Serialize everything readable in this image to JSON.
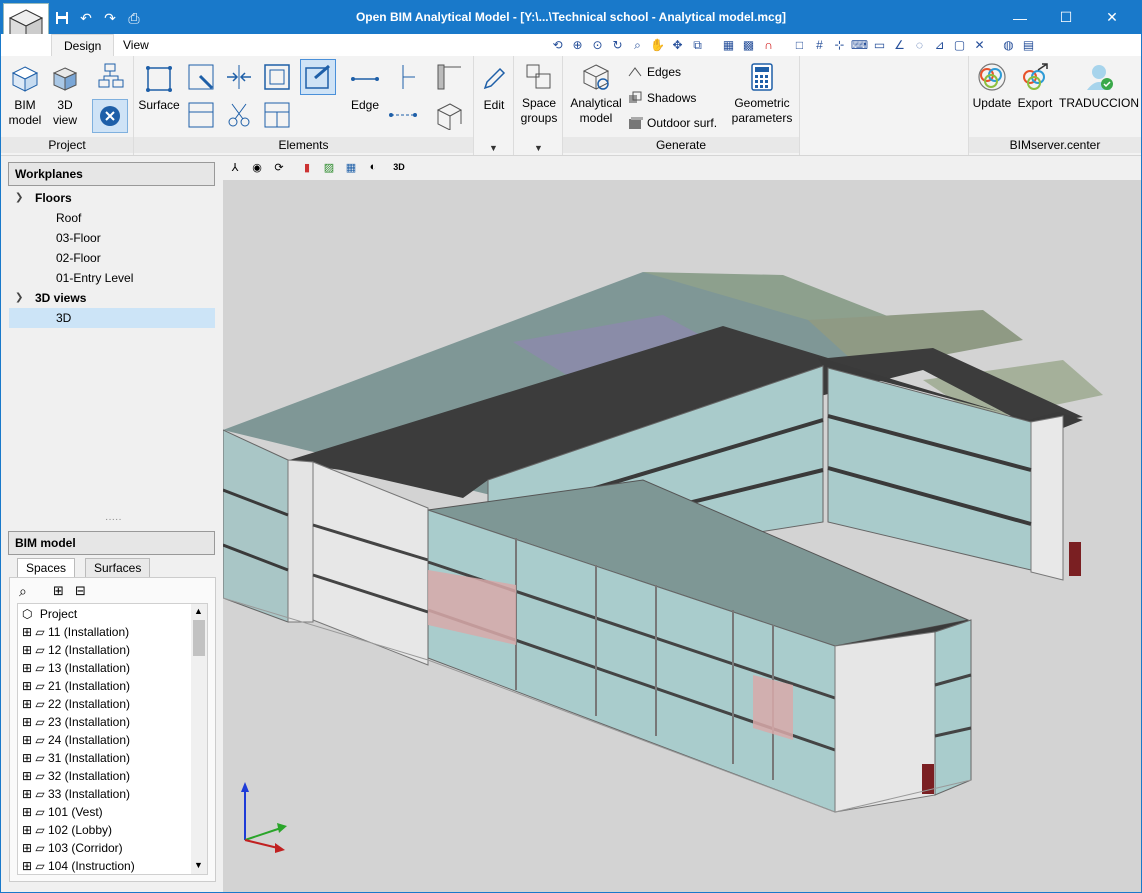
{
  "window": {
    "title": "Open BIM Analytical Model - [Y:\\...\\Technical school - Analytical model.mcg]",
    "minimize": "—",
    "maximize": "☐",
    "close": "✕"
  },
  "tabs": {
    "design": "Design",
    "view": "View"
  },
  "ribbon": {
    "project": {
      "label": "Project",
      "bim_model": "BIM model",
      "view3d": "3D view"
    },
    "elements": {
      "label": "Elements",
      "surface": "Surface",
      "edge": "Edge"
    },
    "edit": {
      "label": "Edit"
    },
    "space_groups": {
      "label": "Space groups"
    },
    "generate": {
      "label": "Generate",
      "analytical_model": "Analytical model",
      "edges": "Edges",
      "shadows": "Shadows",
      "outdoor_surf": "Outdoor surf.",
      "geometric_parameters": "Geometric parameters"
    },
    "bimserver": {
      "label": "BIMserver.center",
      "update": "Update",
      "export": "Export",
      "user": "TRADUCCION"
    }
  },
  "workplanes": {
    "title": "Workplanes",
    "floors_label": "Floors",
    "floors": [
      "Roof",
      "03-Floor",
      "02-Floor",
      "01-Entry Level"
    ],
    "views_label": "3D views",
    "views": [
      "3D"
    ]
  },
  "bim_model": {
    "title": "BIM model",
    "tabs": [
      "Spaces",
      "Surfaces"
    ],
    "root": "Project",
    "items": [
      "11 (Installation)",
      "12 (Installation)",
      "13 (Installation)",
      "21 (Installation)",
      "22 (Installation)",
      "23 (Installation)",
      "24 (Installation)",
      "31 (Installation)",
      "32 (Installation)",
      "33 (Installation)",
      "101 (Vest)",
      "102 (Lobby)",
      "103 (Corridor)",
      "104 (Instruction)"
    ]
  },
  "colors": {
    "titlebar": "#1979ca",
    "viewport_bg": "#d3d3d3",
    "roof_dark": "#3a3a3a",
    "glass": "#a9cfcf",
    "wall": "#e4e4e4"
  },
  "icons": {
    "quick_access": [
      "save-icon",
      "undo-icon",
      "redo-icon",
      "print-icon"
    ],
    "view_toolbar": [
      "axes-icon",
      "orbit-icon",
      "rotate-icon",
      "section-icon",
      "layers-icon",
      "grid-icon",
      "visibility-icon",
      "3d-settings-icon"
    ]
  }
}
